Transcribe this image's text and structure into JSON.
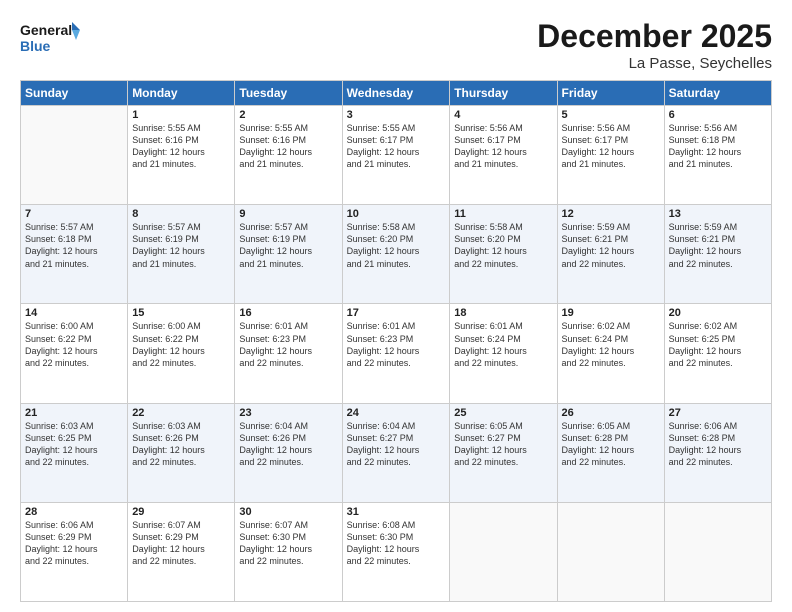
{
  "logo": {
    "line1": "General",
    "line2": "Blue"
  },
  "title": "December 2025",
  "location": "La Passe, Seychelles",
  "days_header": [
    "Sunday",
    "Monday",
    "Tuesday",
    "Wednesday",
    "Thursday",
    "Friday",
    "Saturday"
  ],
  "weeks": [
    [
      {
        "num": "",
        "info": ""
      },
      {
        "num": "1",
        "info": "Sunrise: 5:55 AM\nSunset: 6:16 PM\nDaylight: 12 hours\nand 21 minutes."
      },
      {
        "num": "2",
        "info": "Sunrise: 5:55 AM\nSunset: 6:16 PM\nDaylight: 12 hours\nand 21 minutes."
      },
      {
        "num": "3",
        "info": "Sunrise: 5:55 AM\nSunset: 6:17 PM\nDaylight: 12 hours\nand 21 minutes."
      },
      {
        "num": "4",
        "info": "Sunrise: 5:56 AM\nSunset: 6:17 PM\nDaylight: 12 hours\nand 21 minutes."
      },
      {
        "num": "5",
        "info": "Sunrise: 5:56 AM\nSunset: 6:17 PM\nDaylight: 12 hours\nand 21 minutes."
      },
      {
        "num": "6",
        "info": "Sunrise: 5:56 AM\nSunset: 6:18 PM\nDaylight: 12 hours\nand 21 minutes."
      }
    ],
    [
      {
        "num": "7",
        "info": "Sunrise: 5:57 AM\nSunset: 6:18 PM\nDaylight: 12 hours\nand 21 minutes."
      },
      {
        "num": "8",
        "info": "Sunrise: 5:57 AM\nSunset: 6:19 PM\nDaylight: 12 hours\nand 21 minutes."
      },
      {
        "num": "9",
        "info": "Sunrise: 5:57 AM\nSunset: 6:19 PM\nDaylight: 12 hours\nand 21 minutes."
      },
      {
        "num": "10",
        "info": "Sunrise: 5:58 AM\nSunset: 6:20 PM\nDaylight: 12 hours\nand 21 minutes."
      },
      {
        "num": "11",
        "info": "Sunrise: 5:58 AM\nSunset: 6:20 PM\nDaylight: 12 hours\nand 22 minutes."
      },
      {
        "num": "12",
        "info": "Sunrise: 5:59 AM\nSunset: 6:21 PM\nDaylight: 12 hours\nand 22 minutes."
      },
      {
        "num": "13",
        "info": "Sunrise: 5:59 AM\nSunset: 6:21 PM\nDaylight: 12 hours\nand 22 minutes."
      }
    ],
    [
      {
        "num": "14",
        "info": "Sunrise: 6:00 AM\nSunset: 6:22 PM\nDaylight: 12 hours\nand 22 minutes."
      },
      {
        "num": "15",
        "info": "Sunrise: 6:00 AM\nSunset: 6:22 PM\nDaylight: 12 hours\nand 22 minutes."
      },
      {
        "num": "16",
        "info": "Sunrise: 6:01 AM\nSunset: 6:23 PM\nDaylight: 12 hours\nand 22 minutes."
      },
      {
        "num": "17",
        "info": "Sunrise: 6:01 AM\nSunset: 6:23 PM\nDaylight: 12 hours\nand 22 minutes."
      },
      {
        "num": "18",
        "info": "Sunrise: 6:01 AM\nSunset: 6:24 PM\nDaylight: 12 hours\nand 22 minutes."
      },
      {
        "num": "19",
        "info": "Sunrise: 6:02 AM\nSunset: 6:24 PM\nDaylight: 12 hours\nand 22 minutes."
      },
      {
        "num": "20",
        "info": "Sunrise: 6:02 AM\nSunset: 6:25 PM\nDaylight: 12 hours\nand 22 minutes."
      }
    ],
    [
      {
        "num": "21",
        "info": "Sunrise: 6:03 AM\nSunset: 6:25 PM\nDaylight: 12 hours\nand 22 minutes."
      },
      {
        "num": "22",
        "info": "Sunrise: 6:03 AM\nSunset: 6:26 PM\nDaylight: 12 hours\nand 22 minutes."
      },
      {
        "num": "23",
        "info": "Sunrise: 6:04 AM\nSunset: 6:26 PM\nDaylight: 12 hours\nand 22 minutes."
      },
      {
        "num": "24",
        "info": "Sunrise: 6:04 AM\nSunset: 6:27 PM\nDaylight: 12 hours\nand 22 minutes."
      },
      {
        "num": "25",
        "info": "Sunrise: 6:05 AM\nSunset: 6:27 PM\nDaylight: 12 hours\nand 22 minutes."
      },
      {
        "num": "26",
        "info": "Sunrise: 6:05 AM\nSunset: 6:28 PM\nDaylight: 12 hours\nand 22 minutes."
      },
      {
        "num": "27",
        "info": "Sunrise: 6:06 AM\nSunset: 6:28 PM\nDaylight: 12 hours\nand 22 minutes."
      }
    ],
    [
      {
        "num": "28",
        "info": "Sunrise: 6:06 AM\nSunset: 6:29 PM\nDaylight: 12 hours\nand 22 minutes."
      },
      {
        "num": "29",
        "info": "Sunrise: 6:07 AM\nSunset: 6:29 PM\nDaylight: 12 hours\nand 22 minutes."
      },
      {
        "num": "30",
        "info": "Sunrise: 6:07 AM\nSunset: 6:30 PM\nDaylight: 12 hours\nand 22 minutes."
      },
      {
        "num": "31",
        "info": "Sunrise: 6:08 AM\nSunset: 6:30 PM\nDaylight: 12 hours\nand 22 minutes."
      },
      {
        "num": "",
        "info": ""
      },
      {
        "num": "",
        "info": ""
      },
      {
        "num": "",
        "info": ""
      }
    ]
  ]
}
